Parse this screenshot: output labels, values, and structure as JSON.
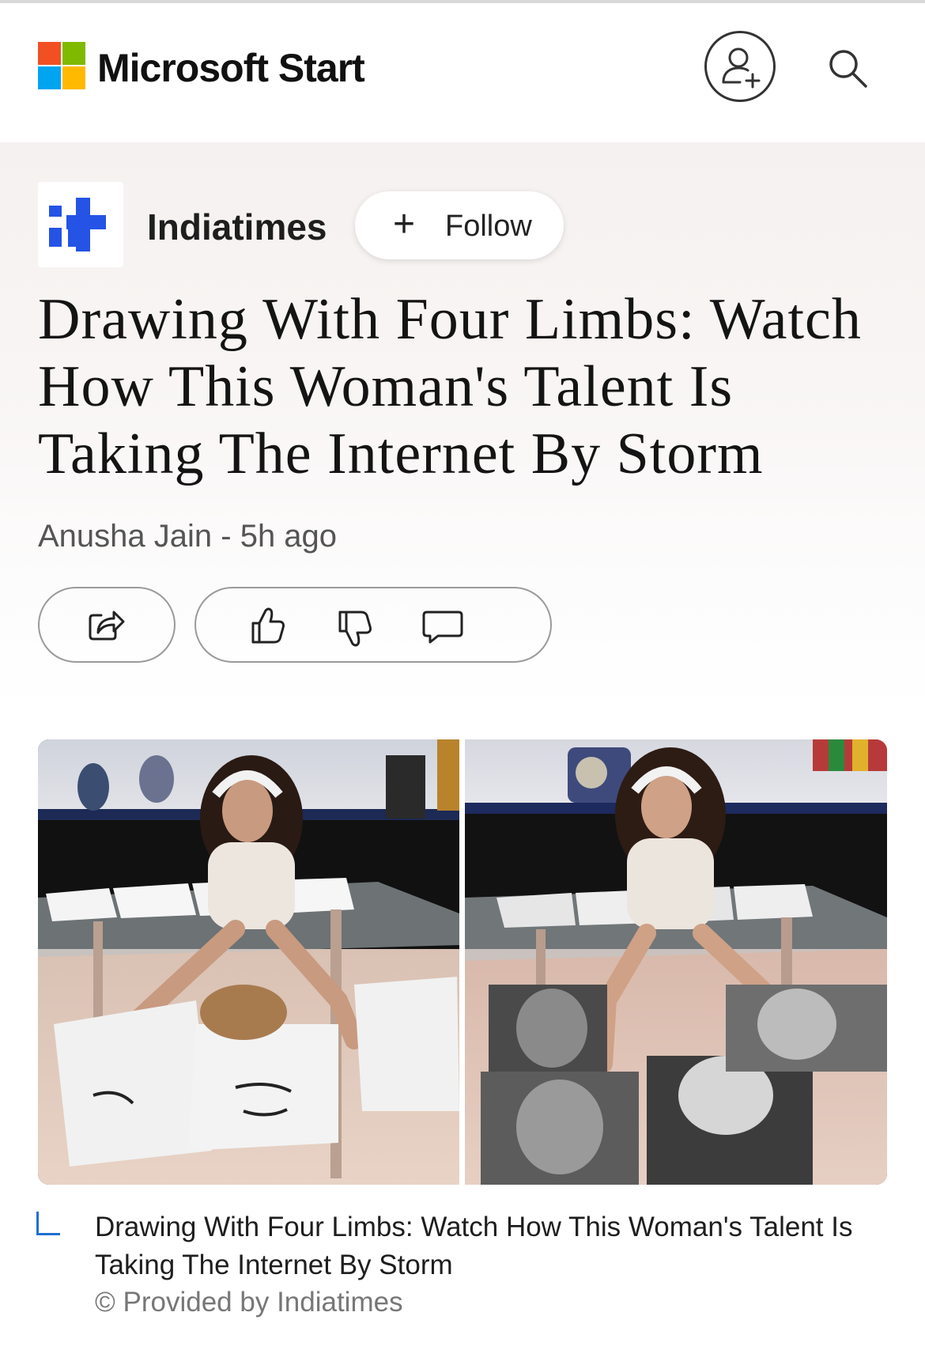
{
  "app": {
    "brand": "Microsoft Start",
    "logo_colors": [
      "#f25022",
      "#7fba00",
      "#00a4ef",
      "#ffb900"
    ],
    "icons": {
      "profile": "add-user-icon",
      "search": "search-icon"
    }
  },
  "publisher": {
    "name": "Indiatimes",
    "logo_color": "#2453e6",
    "follow_label": "Follow",
    "follow_icon": "plus-icon"
  },
  "article": {
    "headline": "Drawing With Four Limbs: Watch How This Woman's Talent Is Taking The Internet By Storm",
    "byline": "Anusha Jain - 5h ago"
  },
  "actions": {
    "share_icon": "share-icon",
    "like_icon": "thumbs-up-icon",
    "dislike_icon": "thumbs-down-icon",
    "comment_icon": "comment-icon"
  },
  "media": {
    "caption": "Drawing With Four Limbs: Watch How This Woman's Talent Is Taking The Internet By Storm",
    "credit": "© Provided by Indiatimes",
    "caption_accent": "#1f6fd1"
  }
}
